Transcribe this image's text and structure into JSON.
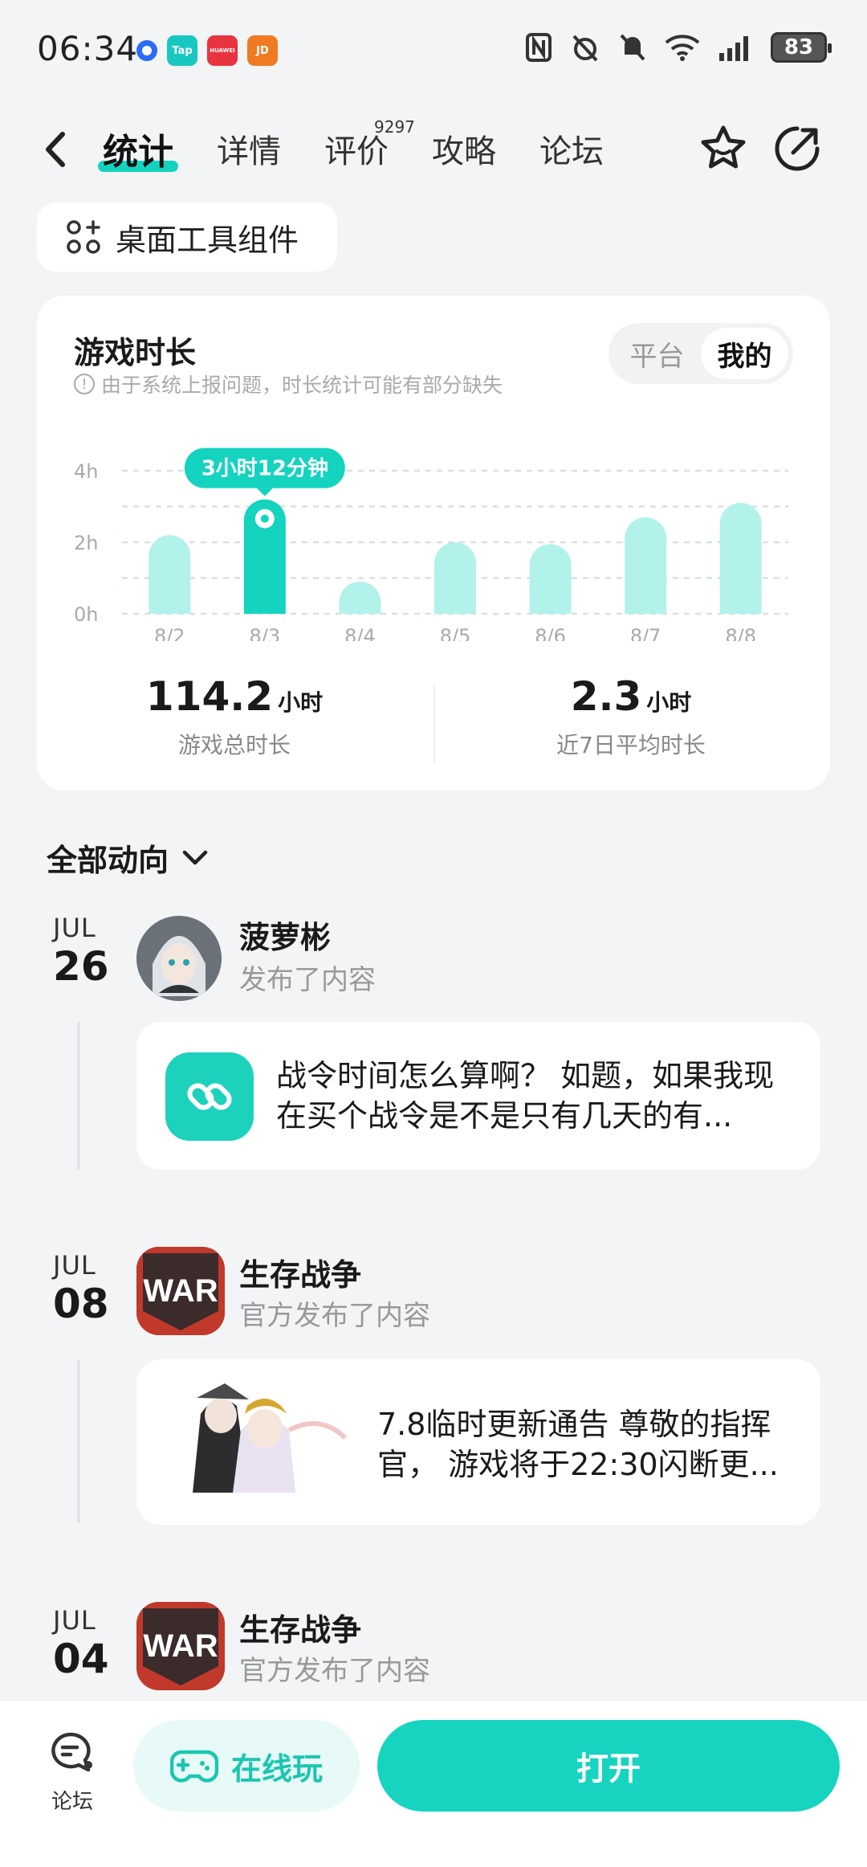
{
  "status_bar": {
    "time": "06:34",
    "apps": [
      {
        "label": "Tap",
        "color": "#18c8c0"
      },
      {
        "label": "HUAWEI",
        "color": "#e8343e"
      },
      {
        "label": "JD",
        "color": "#f07a22"
      }
    ],
    "battery": "83"
  },
  "nav": {
    "tabs": [
      {
        "label": "统计",
        "active": true
      },
      {
        "label": "详情",
        "active": false
      },
      {
        "label": "评价",
        "active": false,
        "badge": "9297"
      },
      {
        "label": "攻略",
        "active": false
      },
      {
        "label": "论坛",
        "active": false
      }
    ]
  },
  "widget_button": {
    "label": "桌面工具组件"
  },
  "stats_card": {
    "title": "游戏时长",
    "note": "由于系统上报问题，时长统计可能有部分缺失",
    "segment": {
      "options": [
        "平台",
        "我的"
      ],
      "selected": "我的"
    },
    "tooltip": "3小时12分钟",
    "total": {
      "value": "114.2",
      "unit": "小时",
      "label": "游戏总时长"
    },
    "average": {
      "value": "2.3",
      "unit": "小时",
      "label": "近7日平均时长"
    }
  },
  "chart_data": {
    "type": "bar",
    "categories": [
      "8/2",
      "8/3",
      "8/4",
      "8/5",
      "8/6",
      "8/7",
      "8/8"
    ],
    "values": [
      2.2,
      3.2,
      0.9,
      2.0,
      1.95,
      2.7,
      3.1
    ],
    "selected_index": 1,
    "y_ticks": [
      "0h",
      "2h",
      "4h"
    ],
    "ylim": [
      0,
      4
    ],
    "grid": true,
    "colors": {
      "bar": "#b2f2ea",
      "selected": "#14d3bf",
      "tooltip": "#14d3bf"
    }
  },
  "feed": {
    "header": "全部动向",
    "items": [
      {
        "month": "JUL",
        "day": "26",
        "author": "菠萝彬",
        "action": "发布了内容",
        "text": "战令时间怎么算啊？ 如题，如果我现在买个战令是不是只有几天的有..."
      },
      {
        "month": "JUL",
        "day": "08",
        "author": "生存战争",
        "action": "官方发布了内容",
        "text": "7.8临时更新通告 尊敬的指挥官， 游戏将于22:30闪断更..."
      },
      {
        "month": "JUL",
        "day": "04",
        "author": "生存战争",
        "action": "官方发布了内容"
      }
    ],
    "logo_text": "WAR"
  },
  "bottom_bar": {
    "forum_label": "论坛",
    "play_online": "在线玩",
    "open": "打开"
  }
}
